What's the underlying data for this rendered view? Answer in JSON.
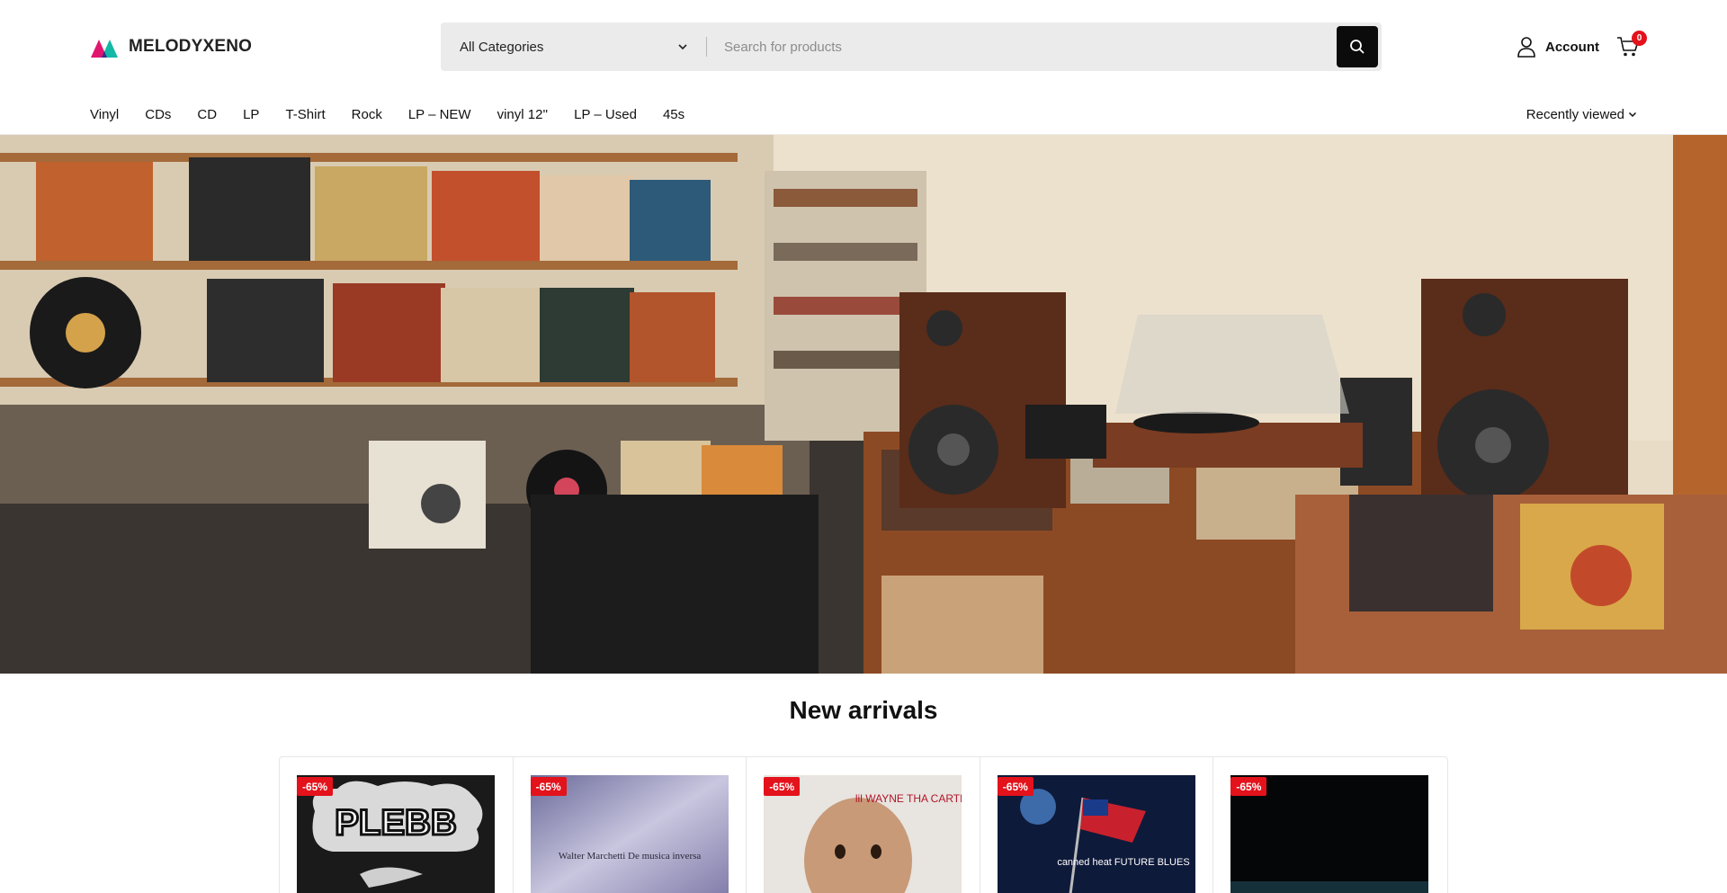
{
  "brand": {
    "name": "MELODYXENO",
    "colors": {
      "accent_magenta": "#e0166e",
      "accent_teal": "#14b8a6",
      "badge_red": "#e3121b"
    }
  },
  "search": {
    "category_label": "All Categories",
    "placeholder": "Search for products",
    "icon": "search-icon"
  },
  "header": {
    "account_label": "Account",
    "cart_count": "0"
  },
  "nav": {
    "items": [
      "Vinyl",
      "CDs",
      "CD",
      "LP",
      "T-Shirt",
      "Rock",
      "LP – NEW",
      "vinyl 12''",
      "LP – Used",
      "45s"
    ],
    "recently_viewed": "Recently viewed"
  },
  "section": {
    "title": "New arrivals"
  },
  "products": [
    {
      "badge": "-65%",
      "cover_text": "PLEBB"
    },
    {
      "badge": "-65%",
      "cover_text": "Walter Marchetti De musica inversa"
    },
    {
      "badge": "-65%",
      "cover_text": "lil WAYNE THA CARTER III"
    },
    {
      "badge": "-65%",
      "cover_text": "canned heat FUTURE BLUES"
    },
    {
      "badge": "-65%",
      "cover_text": ""
    }
  ]
}
